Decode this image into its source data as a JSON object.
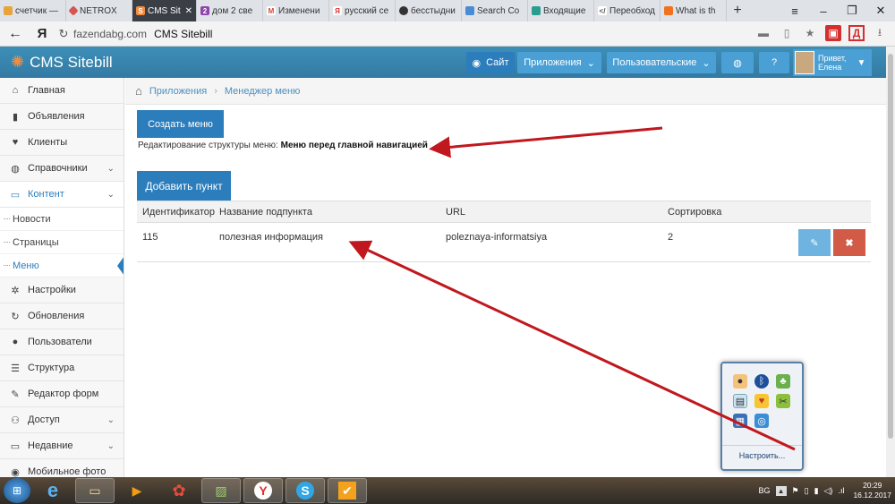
{
  "browser": {
    "tabs": [
      {
        "label": "счетчик —",
        "icon": "bar-chart-icon",
        "color": "#e8a33a"
      },
      {
        "label": "NETROX",
        "icon": "diamond-icon",
        "color": "#d9534f"
      },
      {
        "label": "CMS Sit",
        "icon": "sitebill-icon",
        "color": "#f58b3c",
        "active": true
      },
      {
        "label": "дом 2 све",
        "icon": "mail-badge-icon",
        "color": "#8e44ad"
      },
      {
        "label": "Изменени",
        "icon": "gmail-icon",
        "color": "#d44638"
      },
      {
        "label": "русский се",
        "icon": "yandex-icon",
        "color": "#e62e2e"
      },
      {
        "label": "бесстыдни",
        "icon": "mask-icon",
        "color": "#333333"
      },
      {
        "label": "Search Co",
        "icon": "search-console-icon",
        "color": "#4a8bd6"
      },
      {
        "label": "Входящие",
        "icon": "mail-icon",
        "color": "#2a9d8f"
      },
      {
        "label": "Переобход",
        "icon": "code-icon",
        "color": "#555555"
      },
      {
        "label": "What is th",
        "icon": "grid-icon",
        "color": "#f2711c"
      }
    ],
    "new_tab": "+",
    "address": {
      "host": "fazendabg.com",
      "title": "CMS Sitebill",
      "back": "←",
      "yandex": "Я",
      "reload": "↻"
    }
  },
  "topnav": {
    "brand": "CMS Sitebill",
    "site_btn": "Сайт",
    "apps_btn": "Приложения",
    "custom_btn": "Пользовательские",
    "greet_line1": "Привет,",
    "greet_line2": "Елена"
  },
  "sidebar": {
    "items": [
      {
        "label": "Главная",
        "icon": "home-icon",
        "glyph": "⌂"
      },
      {
        "label": "Объявления",
        "icon": "book-icon",
        "glyph": "▮"
      },
      {
        "label": "Клиенты",
        "icon": "heart-icon",
        "glyph": "♥"
      },
      {
        "label": "Справочники",
        "icon": "globe-icon",
        "glyph": "◍",
        "chevron": true
      },
      {
        "label": "Контент",
        "icon": "desktop-icon",
        "glyph": "▭",
        "chevron": true,
        "active": true
      }
    ],
    "subitems": [
      {
        "label": "Новости"
      },
      {
        "label": "Страницы"
      },
      {
        "label": "Меню",
        "current": true
      }
    ],
    "items2": [
      {
        "label": "Настройки",
        "icon": "cog-icon",
        "glyph": "✲"
      },
      {
        "label": "Обновления",
        "icon": "refresh-icon",
        "glyph": "↻"
      },
      {
        "label": "Пользователи",
        "icon": "user-icon",
        "glyph": "●"
      },
      {
        "label": "Структура",
        "icon": "list-icon",
        "glyph": "☰"
      },
      {
        "label": "Редактор форм",
        "icon": "edit-icon",
        "glyph": "✎"
      },
      {
        "label": "Доступ",
        "icon": "group-icon",
        "glyph": "⚇",
        "chevron": true
      },
      {
        "label": "Недавние",
        "icon": "monitor-icon",
        "glyph": "▭",
        "chevron": true
      },
      {
        "label": "Мобильное фото",
        "icon": "camera-icon",
        "glyph": "◉"
      }
    ]
  },
  "breadcrumb": {
    "root": "Приложения",
    "current": "Менеджер меню"
  },
  "main": {
    "create_menu_btn": "Создать меню",
    "struct_prefix": "Редактирование структуры меню:",
    "struct_name": "Меню перед главной навигацией",
    "add_item_btn": "Добавить пункт"
  },
  "table": {
    "headers": [
      "Идентификатор",
      "Название подпункта",
      "URL",
      "Сортировка"
    ],
    "rows": [
      {
        "id": "115",
        "name": "полезная информация",
        "url": "poleznaya-informatsiya",
        "sort": "2"
      }
    ]
  },
  "tray": {
    "customize": "Настроить..."
  },
  "taskbar": {
    "lang": "BG",
    "time": "20:29",
    "date": "16.12.2017"
  },
  "colors": {
    "nav": "#3a87ad",
    "primary": "#2b7dbc",
    "danger": "#d15b47",
    "info": "#6fb3e0",
    "arrow": "#c0181e"
  }
}
